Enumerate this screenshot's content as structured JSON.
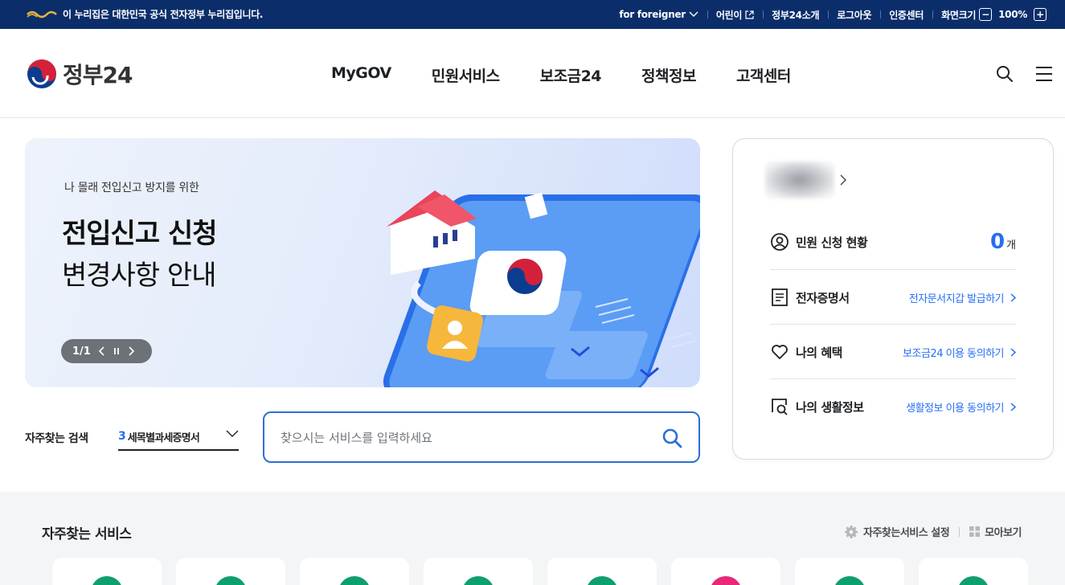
{
  "gov_bar": {
    "notice": "이 누리집은 대한민국 공식 전자정부 누리집입니다.",
    "links": [
      "for foreigner",
      "어린이",
      "정부24소개",
      "로그아웃",
      "인증센터"
    ],
    "zoom_label": "화면크기",
    "zoom_value": "100%",
    "zoom_minus": "−",
    "zoom_plus": "+"
  },
  "header": {
    "logo": "정부24",
    "nav": [
      "MyGOV",
      "민원서비스",
      "보조금24",
      "정책정보",
      "고객센터"
    ]
  },
  "hero": {
    "subtitle": "나 몰래 전입신고 방지를 위한",
    "title_line1": "전입신고 신청",
    "title_line2": "변경사항 안내",
    "pager": "1/1"
  },
  "frequent_search": {
    "label": "자주찾는 검색",
    "rank": "3",
    "selected": "세목별과세증명서",
    "placeholder": "찾으시는 서비스를 입력하세요"
  },
  "profile_card": {
    "rows": [
      {
        "label": "민원 신청 현황",
        "count": "0",
        "unit": "개"
      },
      {
        "label": "전자증명서",
        "link": "전자문서지갑 발급하기"
      },
      {
        "label": "나의 혜택",
        "link": "보조금24 이용 동의하기"
      },
      {
        "label": "나의 생활정보",
        "link": "생활정보 이용 동의하기"
      }
    ]
  },
  "services": {
    "title": "자주찾는 서비스",
    "settings": "자주찾는서비스 설정",
    "view_all": "모아보기",
    "tile_colors": [
      "#0f9f6e",
      "#0f9f6e",
      "#0f9f6e",
      "#0f9f6e",
      "#0f9f6e",
      "#e8287a",
      "#0f9f6e",
      "#0f9f6e"
    ]
  },
  "colors": {
    "gov_bar": "#0b2e6b",
    "accent": "#256ef4",
    "search_border": "#2b6fd6"
  }
}
